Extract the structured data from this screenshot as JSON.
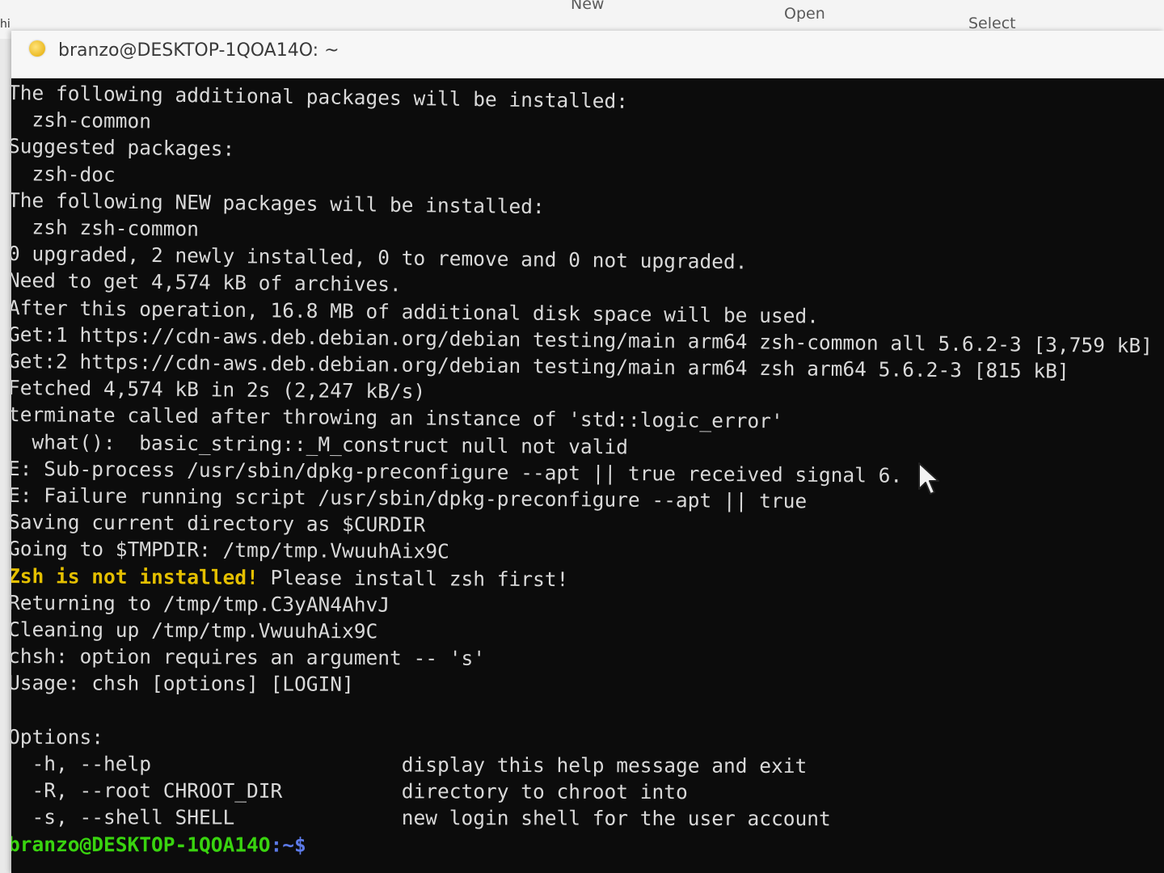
{
  "explorer": {
    "left_crumb": "hi",
    "ribbon": {
      "new_label": "New",
      "open_label": "Open",
      "select_label": "Select"
    }
  },
  "window": {
    "title": "branzo@DESKTOP-1QOA14O: ~"
  },
  "terminal": {
    "lines": [
      "The following additional packages will be installed:",
      "  zsh-common",
      "Suggested packages:",
      "  zsh-doc",
      "The following NEW packages will be installed:",
      "  zsh zsh-common",
      "0 upgraded, 2 newly installed, 0 to remove and 0 not upgraded.",
      "Need to get 4,574 kB of archives.",
      "After this operation, 16.8 MB of additional disk space will be used.",
      "Get:1 https://cdn-aws.deb.debian.org/debian testing/main arm64 zsh-common all 5.6.2-3 [3,759 kB]",
      "Get:2 https://cdn-aws.deb.debian.org/debian testing/main arm64 zsh arm64 5.6.2-3 [815 kB]",
      "Fetched 4,574 kB in 2s (2,247 kB/s)",
      "terminate called after throwing an instance of 'std::logic_error'",
      "  what():  basic_string::_M_construct null not valid",
      "E: Sub-process /usr/sbin/dpkg-preconfigure --apt || true received signal 6.",
      "E: Failure running script /usr/sbin/dpkg-preconfigure --apt || true",
      "Saving current directory as $CURDIR",
      "Going to $TMPDIR: /tmp/tmp.VwuuhAix9C"
    ],
    "zsh_warning": "Zsh is not installed!",
    "zsh_warning_rest": " Please install zsh first!",
    "lines_after": [
      "Returning to /tmp/tmp.C3yAN4AhvJ",
      "Cleaning up /tmp/tmp.VwuuhAix9C",
      "chsh: option requires an argument -- 's'",
      "Usage: chsh [options] [LOGIN]",
      "",
      "Options:",
      "  -h, --help                     display this help message and exit",
      "  -R, --root CHROOT_DIR          directory to chroot into",
      "  -s, --shell SHELL              new login shell for the user account"
    ],
    "prompt_user": "branzo@DESKTOP-1QOA14O",
    "prompt_path": ":~$"
  },
  "colors": {
    "background": "#0c0c0c",
    "text": "#d9d9d9",
    "warning": "#e5c000",
    "prompt_user": "#39d40f",
    "prompt_path": "#5c7ae8"
  },
  "cursor": {
    "icon": "mouse-pointer-icon"
  }
}
